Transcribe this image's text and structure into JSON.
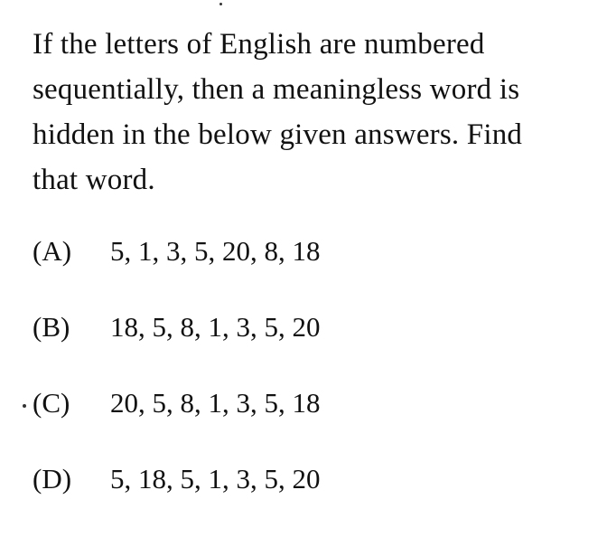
{
  "question": {
    "lines": [
      "If the letters of English are numbered",
      "sequentially, then a meaningless word is",
      "hidden in the below given answers.  Find",
      "that word."
    ]
  },
  "options": [
    {
      "label": "(A)",
      "value": "5, 1, 3, 5, 20, 8, 18"
    },
    {
      "label": "(B)",
      "value": "18, 5, 8, 1, 3, 5, 20"
    },
    {
      "label": "(C)",
      "value": "20, 5, 8, 1, 3, 5, 18"
    },
    {
      "label": "(D)",
      "value": "5, 18, 5, 1, 3, 5, 20"
    }
  ]
}
